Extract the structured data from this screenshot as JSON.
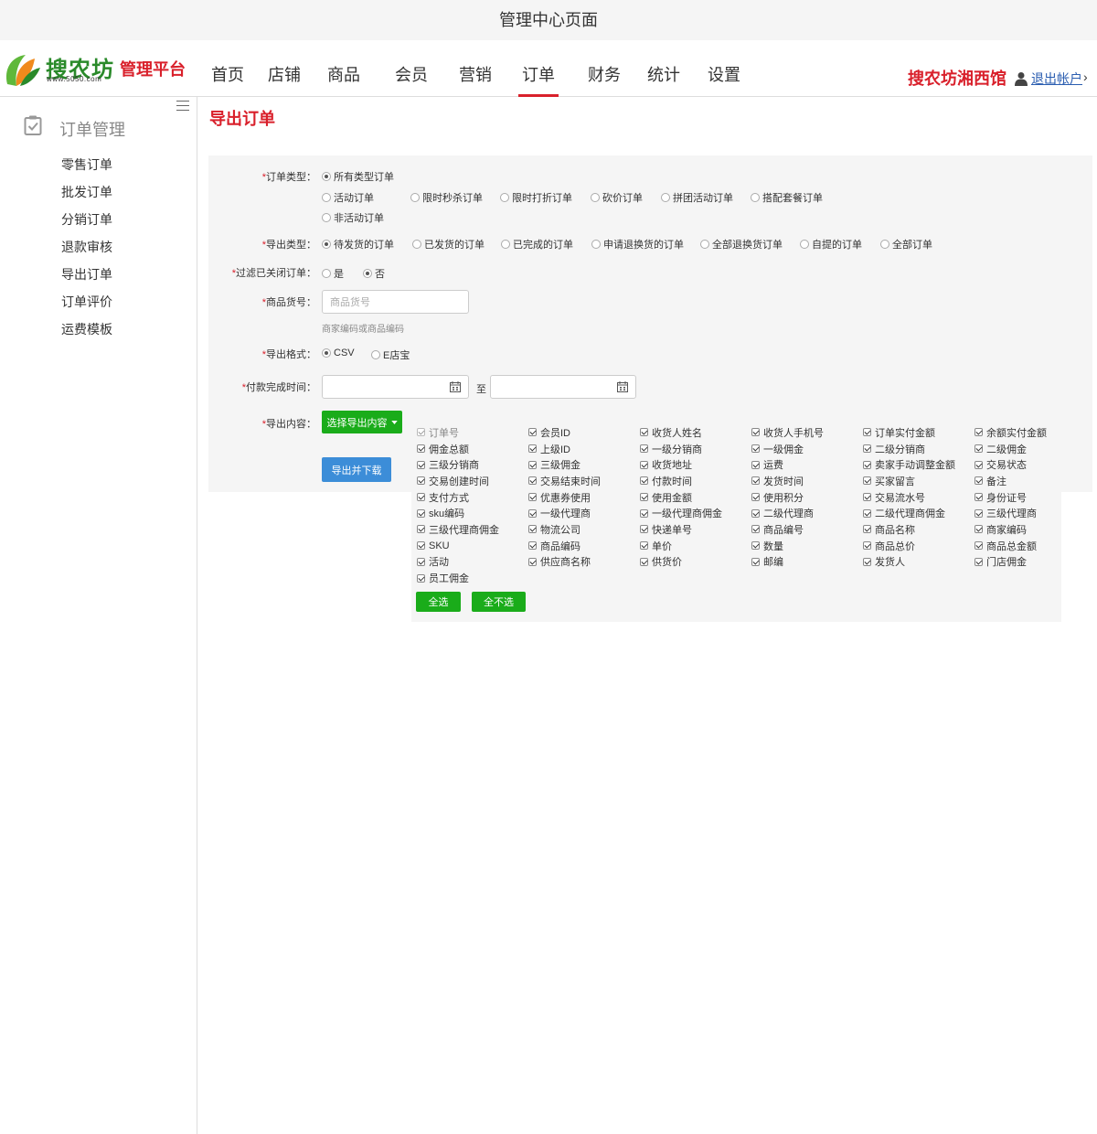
{
  "browser": {
    "title": "管理中心页面"
  },
  "header": {
    "logo_text": "搜农坊",
    "logo_url": "www.5050.com",
    "platform": "管理平台",
    "nav": [
      "首页",
      "店铺",
      "商品",
      "会员",
      "营销",
      "订单",
      "财务",
      "统计",
      "设置"
    ],
    "active_nav": "订单",
    "shop_name": "搜农坊湘西馆",
    "logout": "退出帐户",
    "logout_arrow": "›"
  },
  "sidebar": {
    "heading": "订单管理",
    "items": [
      "零售订单",
      "批发订单",
      "分销订单",
      "退款审核",
      "导出订单",
      "订单评价",
      "运费模板"
    ]
  },
  "page": {
    "title": "导出订单"
  },
  "form": {
    "order_type": {
      "label": "订单类型：",
      "options": [
        "所有类型订单",
        "活动订单",
        "限时秒杀订单",
        "限时打折订单",
        "砍价订单",
        "拼团活动订单",
        "搭配套餐订单",
        "非活动订单"
      ],
      "selected": "所有类型订单"
    },
    "export_type": {
      "label": "导出类型：",
      "options": [
        "待发货的订单",
        "已发货的订单",
        "已完成的订单",
        "申请退换货的订单",
        "全部退换货订单",
        "自提的订单",
        "全部订单"
      ],
      "selected": "待发货的订单"
    },
    "filter_closed": {
      "label": "过滤已关闭订单：",
      "options": [
        "是",
        "否"
      ],
      "selected": "否"
    },
    "sku": {
      "label": "商品货号：",
      "placeholder": "商品货号",
      "hint": "商家编码或商品编码"
    },
    "format": {
      "label": "导出格式：",
      "options": [
        "CSV",
        "E店宝"
      ],
      "selected": "CSV"
    },
    "pay_time": {
      "label": "付款完成时间：",
      "start": "",
      "end": "",
      "separator": "至"
    },
    "content": {
      "label": "导出内容：",
      "dropdown_label": "选择导出内容",
      "fields": [
        "订单号",
        "会员ID",
        "收货人姓名",
        "收货人手机号",
        "订单实付金额",
        "余额实付金额",
        "佣金总额",
        "上级ID",
        "一级分销商",
        "一级佣金",
        "二级分销商",
        "二级佣金",
        "三级分销商",
        "三级佣金",
        "收货地址",
        "运费",
        "卖家手动调整金额",
        "交易状态",
        "交易创建时间",
        "交易结束时间",
        "付款时间",
        "发货时间",
        "买家留言",
        "备注",
        "支付方式",
        "优惠券使用",
        "使用金额",
        "使用积分",
        "交易流水号",
        "身份证号",
        "sku编码",
        "一级代理商",
        "一级代理商佣金",
        "二级代理商",
        "二级代理商佣金",
        "三级代理商",
        "三级代理商佣金",
        "物流公司",
        "快递单号",
        "商品编号",
        "商品名称",
        "商家编码",
        "SKU",
        "商品编码",
        "单价",
        "数量",
        "商品总价",
        "商品总金额",
        "活动",
        "供应商名称",
        "供货价",
        "邮编",
        "发货人",
        "门店佣金",
        "员工佣金"
      ],
      "select_all": "全选",
      "select_none": "全不选"
    },
    "submit": "导出并下载"
  },
  "colors": {
    "brand_red": "#d9202b",
    "brand_green": "#1aac1a",
    "button_blue": "#3c8dd8"
  }
}
